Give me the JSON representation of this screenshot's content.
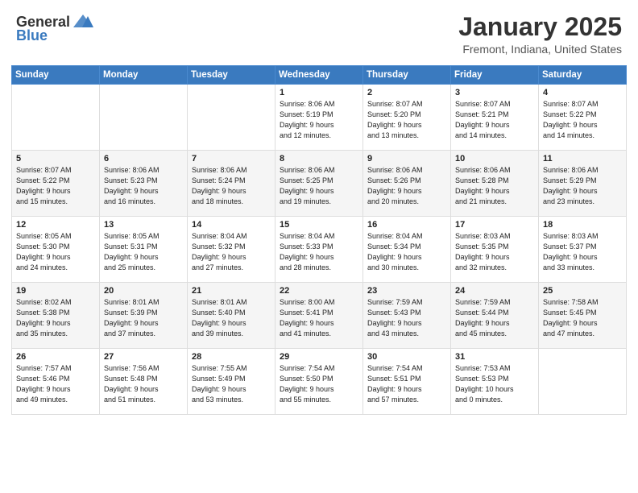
{
  "header": {
    "logo_general": "General",
    "logo_blue": "Blue",
    "month_title": "January 2025",
    "location": "Fremont, Indiana, United States"
  },
  "weekdays": [
    "Sunday",
    "Monday",
    "Tuesday",
    "Wednesday",
    "Thursday",
    "Friday",
    "Saturday"
  ],
  "weeks": [
    [
      {
        "day": "",
        "info": ""
      },
      {
        "day": "",
        "info": ""
      },
      {
        "day": "",
        "info": ""
      },
      {
        "day": "1",
        "info": "Sunrise: 8:06 AM\nSunset: 5:19 PM\nDaylight: 9 hours\nand 12 minutes."
      },
      {
        "day": "2",
        "info": "Sunrise: 8:07 AM\nSunset: 5:20 PM\nDaylight: 9 hours\nand 13 minutes."
      },
      {
        "day": "3",
        "info": "Sunrise: 8:07 AM\nSunset: 5:21 PM\nDaylight: 9 hours\nand 14 minutes."
      },
      {
        "day": "4",
        "info": "Sunrise: 8:07 AM\nSunset: 5:22 PM\nDaylight: 9 hours\nand 14 minutes."
      }
    ],
    [
      {
        "day": "5",
        "info": "Sunrise: 8:07 AM\nSunset: 5:22 PM\nDaylight: 9 hours\nand 15 minutes."
      },
      {
        "day": "6",
        "info": "Sunrise: 8:06 AM\nSunset: 5:23 PM\nDaylight: 9 hours\nand 16 minutes."
      },
      {
        "day": "7",
        "info": "Sunrise: 8:06 AM\nSunset: 5:24 PM\nDaylight: 9 hours\nand 18 minutes."
      },
      {
        "day": "8",
        "info": "Sunrise: 8:06 AM\nSunset: 5:25 PM\nDaylight: 9 hours\nand 19 minutes."
      },
      {
        "day": "9",
        "info": "Sunrise: 8:06 AM\nSunset: 5:26 PM\nDaylight: 9 hours\nand 20 minutes."
      },
      {
        "day": "10",
        "info": "Sunrise: 8:06 AM\nSunset: 5:28 PM\nDaylight: 9 hours\nand 21 minutes."
      },
      {
        "day": "11",
        "info": "Sunrise: 8:06 AM\nSunset: 5:29 PM\nDaylight: 9 hours\nand 23 minutes."
      }
    ],
    [
      {
        "day": "12",
        "info": "Sunrise: 8:05 AM\nSunset: 5:30 PM\nDaylight: 9 hours\nand 24 minutes."
      },
      {
        "day": "13",
        "info": "Sunrise: 8:05 AM\nSunset: 5:31 PM\nDaylight: 9 hours\nand 25 minutes."
      },
      {
        "day": "14",
        "info": "Sunrise: 8:04 AM\nSunset: 5:32 PM\nDaylight: 9 hours\nand 27 minutes."
      },
      {
        "day": "15",
        "info": "Sunrise: 8:04 AM\nSunset: 5:33 PM\nDaylight: 9 hours\nand 28 minutes."
      },
      {
        "day": "16",
        "info": "Sunrise: 8:04 AM\nSunset: 5:34 PM\nDaylight: 9 hours\nand 30 minutes."
      },
      {
        "day": "17",
        "info": "Sunrise: 8:03 AM\nSunset: 5:35 PM\nDaylight: 9 hours\nand 32 minutes."
      },
      {
        "day": "18",
        "info": "Sunrise: 8:03 AM\nSunset: 5:37 PM\nDaylight: 9 hours\nand 33 minutes."
      }
    ],
    [
      {
        "day": "19",
        "info": "Sunrise: 8:02 AM\nSunset: 5:38 PM\nDaylight: 9 hours\nand 35 minutes."
      },
      {
        "day": "20",
        "info": "Sunrise: 8:01 AM\nSunset: 5:39 PM\nDaylight: 9 hours\nand 37 minutes."
      },
      {
        "day": "21",
        "info": "Sunrise: 8:01 AM\nSunset: 5:40 PM\nDaylight: 9 hours\nand 39 minutes."
      },
      {
        "day": "22",
        "info": "Sunrise: 8:00 AM\nSunset: 5:41 PM\nDaylight: 9 hours\nand 41 minutes."
      },
      {
        "day": "23",
        "info": "Sunrise: 7:59 AM\nSunset: 5:43 PM\nDaylight: 9 hours\nand 43 minutes."
      },
      {
        "day": "24",
        "info": "Sunrise: 7:59 AM\nSunset: 5:44 PM\nDaylight: 9 hours\nand 45 minutes."
      },
      {
        "day": "25",
        "info": "Sunrise: 7:58 AM\nSunset: 5:45 PM\nDaylight: 9 hours\nand 47 minutes."
      }
    ],
    [
      {
        "day": "26",
        "info": "Sunrise: 7:57 AM\nSunset: 5:46 PM\nDaylight: 9 hours\nand 49 minutes."
      },
      {
        "day": "27",
        "info": "Sunrise: 7:56 AM\nSunset: 5:48 PM\nDaylight: 9 hours\nand 51 minutes."
      },
      {
        "day": "28",
        "info": "Sunrise: 7:55 AM\nSunset: 5:49 PM\nDaylight: 9 hours\nand 53 minutes."
      },
      {
        "day": "29",
        "info": "Sunrise: 7:54 AM\nSunset: 5:50 PM\nDaylight: 9 hours\nand 55 minutes."
      },
      {
        "day": "30",
        "info": "Sunrise: 7:54 AM\nSunset: 5:51 PM\nDaylight: 9 hours\nand 57 minutes."
      },
      {
        "day": "31",
        "info": "Sunrise: 7:53 AM\nSunset: 5:53 PM\nDaylight: 10 hours\nand 0 minutes."
      },
      {
        "day": "",
        "info": ""
      }
    ]
  ]
}
